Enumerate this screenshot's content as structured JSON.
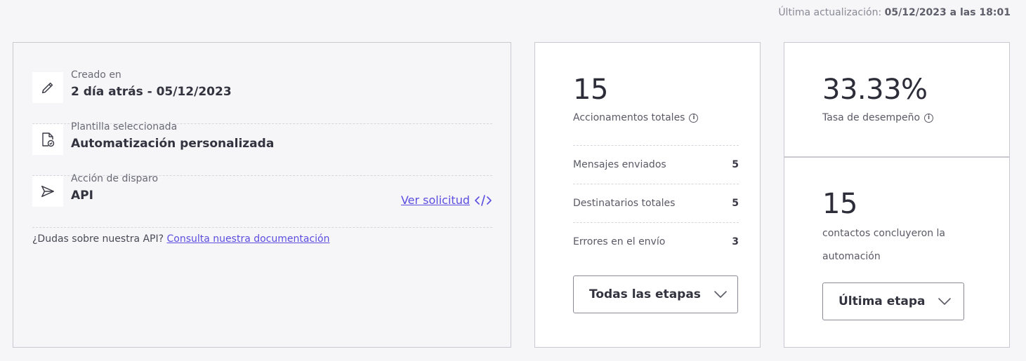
{
  "header": {
    "updated_label": "Última actualización:",
    "updated_value": "05/12/2023 a las 18:01"
  },
  "info": {
    "created": {
      "label": "Creado en",
      "value": "2 día atrás - 05/12/2023",
      "icon": "pencil-icon"
    },
    "template": {
      "label": "Plantilla seleccionada",
      "value": "Automatización personalizada",
      "icon": "file-check-icon"
    },
    "trigger": {
      "label": "Acción de disparo",
      "value": "API",
      "icon": "send-icon",
      "link": "Ver solicitud"
    },
    "api_help": {
      "question": "¿Dudas sobre nuestra API?",
      "link": "Consulta nuestra documentación"
    }
  },
  "actions": {
    "total": "15",
    "total_label": "Accionamentos totales",
    "metrics": [
      {
        "label": "Mensajes enviados",
        "value": "5"
      },
      {
        "label": "Destinatarios totales",
        "value": "5"
      },
      {
        "label": "Errores en el envío",
        "value": "3"
      }
    ],
    "dropdown": "Todas las etapas"
  },
  "rate": {
    "value": "33.33%",
    "label": "Tasa de desempeño"
  },
  "contacts": {
    "value": "15",
    "label": "contactos concluyeron la automación",
    "dropdown": "Última etapa"
  },
  "colors": {
    "accent": "#5b4de0",
    "border": "#c9c9d1",
    "background": "#f6f6f8"
  }
}
